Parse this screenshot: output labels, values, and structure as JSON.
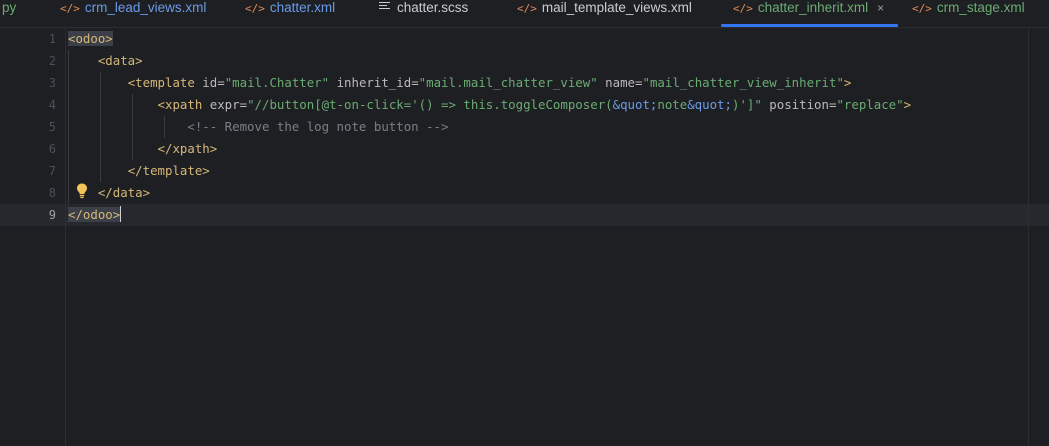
{
  "tabs": [
    {
      "id": "py",
      "label": "py",
      "style": "cut",
      "icon": ""
    },
    {
      "id": "crm_lead_views",
      "label": "crm_lead_views.xml",
      "style": "xml",
      "icon": "</>"
    },
    {
      "id": "chatter_xml",
      "label": "chatter.xml",
      "style": "xml",
      "icon": "</>"
    },
    {
      "id": "chatter_scss",
      "label": "chatter.scss",
      "style": "plain",
      "icon": "lines"
    },
    {
      "id": "mail_template_views",
      "label": "mail_template_views.xml",
      "style": "plain",
      "icon": "</>"
    },
    {
      "id": "chatter_inherit",
      "label": "chatter_inherit.xml",
      "style": "active",
      "icon": "</>",
      "close": "×"
    },
    {
      "id": "crm_stage",
      "label": "crm_stage.xml",
      "style": "stage",
      "icon": "</>"
    }
  ],
  "line_numbers": [
    "1",
    "2",
    "3",
    "4",
    "5",
    "6",
    "7",
    "8",
    "9"
  ],
  "current_line": "9",
  "code": {
    "l1": {
      "open": "<odoo>"
    },
    "l2": {
      "open": "<data>"
    },
    "l3": {
      "tag_open": "<template",
      "a1": "id=",
      "v1": "\"mail.Chatter\"",
      "a2": "inherit_id=",
      "v2": "\"mail.mail_chatter_view\"",
      "a3": "name=",
      "v3": "\"mail_chatter_view_inherit\"",
      "tag_close": ">"
    },
    "l4": {
      "tag_open": "<xpath",
      "a1": "expr=",
      "v1a": "\"//button[@t-on-click='() => this.toggleComposer(",
      "e1": "&quot;",
      "v1b": "note",
      "e2": "&quot;",
      "v1c": ")']\"",
      "a2": "position=",
      "v2": "\"replace\"",
      "tag_close": ">"
    },
    "l5": {
      "comment": "<!-- Remove the log note button -->"
    },
    "l6": {
      "close": "</xpath>"
    },
    "l7": {
      "close": "</template>"
    },
    "l8": {
      "close": "</data>"
    },
    "l9": {
      "close": "</odoo>"
    }
  },
  "colors": {
    "background": "#1e1f22",
    "tag": "#d5b778",
    "string": "#6aab73",
    "entity": "#6b9be8",
    "comment": "#7a7e85",
    "active_tab_underline": "#3574f0"
  },
  "icons": {
    "xml_tab": "code-brackets-icon",
    "scss_tab": "text-lines-icon",
    "gutter": "lightbulb-icon",
    "close": "close-icon"
  }
}
